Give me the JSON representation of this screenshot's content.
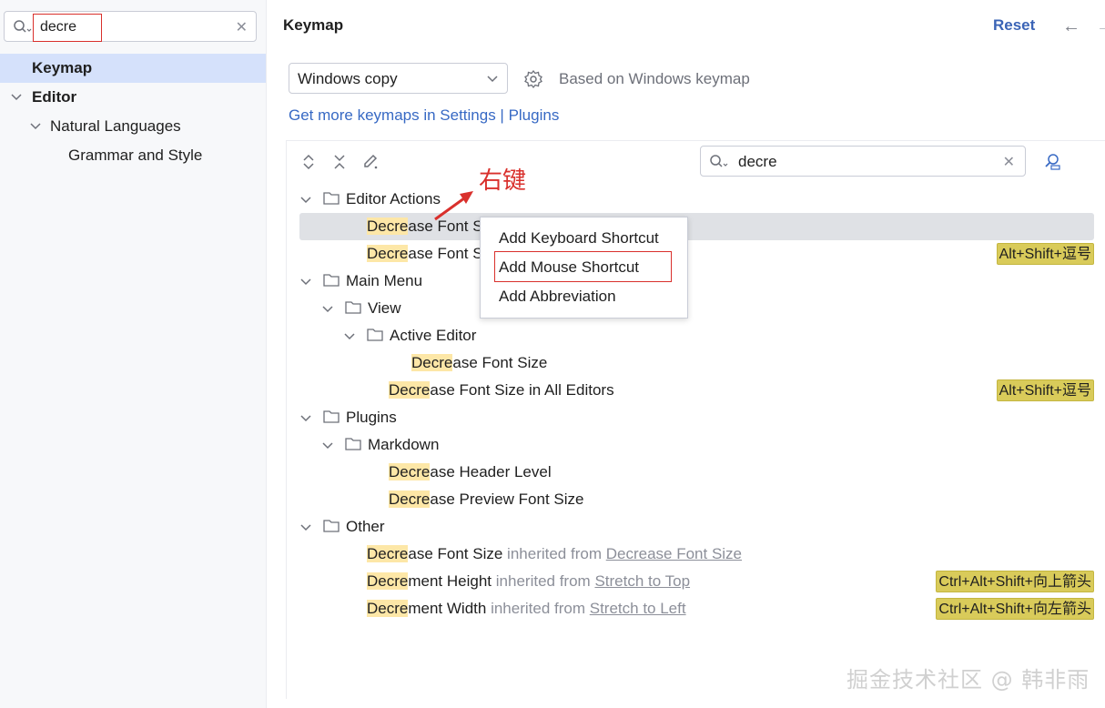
{
  "sidebar": {
    "search_value": "decre",
    "items": [
      {
        "label": "Keymap"
      },
      {
        "label": "Editor"
      },
      {
        "label": "Natural Languages"
      },
      {
        "label": "Grammar and Style"
      }
    ]
  },
  "header": {
    "title": "Keymap",
    "reset": "Reset"
  },
  "keymap": {
    "selected": "Windows copy",
    "based_on": "Based on Windows keymap",
    "get_more": "Get more keymaps in Settings | Plugins"
  },
  "tree_search": {
    "value": "decre"
  },
  "tree": {
    "editor_actions": "Editor Actions",
    "ea_row1": {
      "hl": "Decre",
      "rest": "ase Font S"
    },
    "ea_row2": {
      "hl": "Decre",
      "rest": "ase Font S",
      "shortcut": "Alt+Shift+逗号"
    },
    "main_menu": "Main Menu",
    "view": "View",
    "active_editor": "Active Editor",
    "ae_row1": {
      "hl": "Decre",
      "rest": "ase Font Size"
    },
    "mm_row2": {
      "hl": "Decre",
      "rest": "ase Font Size in All Editors",
      "shortcut": "Alt+Shift+逗号"
    },
    "plugins": "Plugins",
    "markdown": "Markdown",
    "md_row1": {
      "hl": "Decre",
      "rest": "ase Header Level"
    },
    "md_row2": {
      "hl": "Decre",
      "rest": "ase Preview Font Size"
    },
    "other": "Other",
    "ot_row1": {
      "hl": "Decre",
      "rest": "ase Font Size",
      "inherited": "inherited from",
      "link": "Decrease Font Size"
    },
    "ot_row2": {
      "hl": "Decre",
      "rest": "ment Height",
      "inherited": "inherited from",
      "link": "Stretch to Top",
      "shortcut": "Ctrl+Alt+Shift+向上箭头"
    },
    "ot_row3": {
      "hl": "Decre",
      "rest": "ment Width",
      "inherited": "inherited from",
      "link": "Stretch to Left",
      "shortcut": "Ctrl+Alt+Shift+向左箭头"
    }
  },
  "context_menu": {
    "items": [
      "Add Keyboard Shortcut",
      "Add Mouse Shortcut",
      "Add Abbreviation"
    ]
  },
  "annotation": "右键",
  "watermark": "掘金技术社区 @ 韩非雨",
  "colors": {
    "accent": "#3769c4",
    "selection": "#d5e1fb",
    "highlight": "#fde7a7",
    "shortcut": "#d9cb5a",
    "annotation": "#d9302c"
  }
}
